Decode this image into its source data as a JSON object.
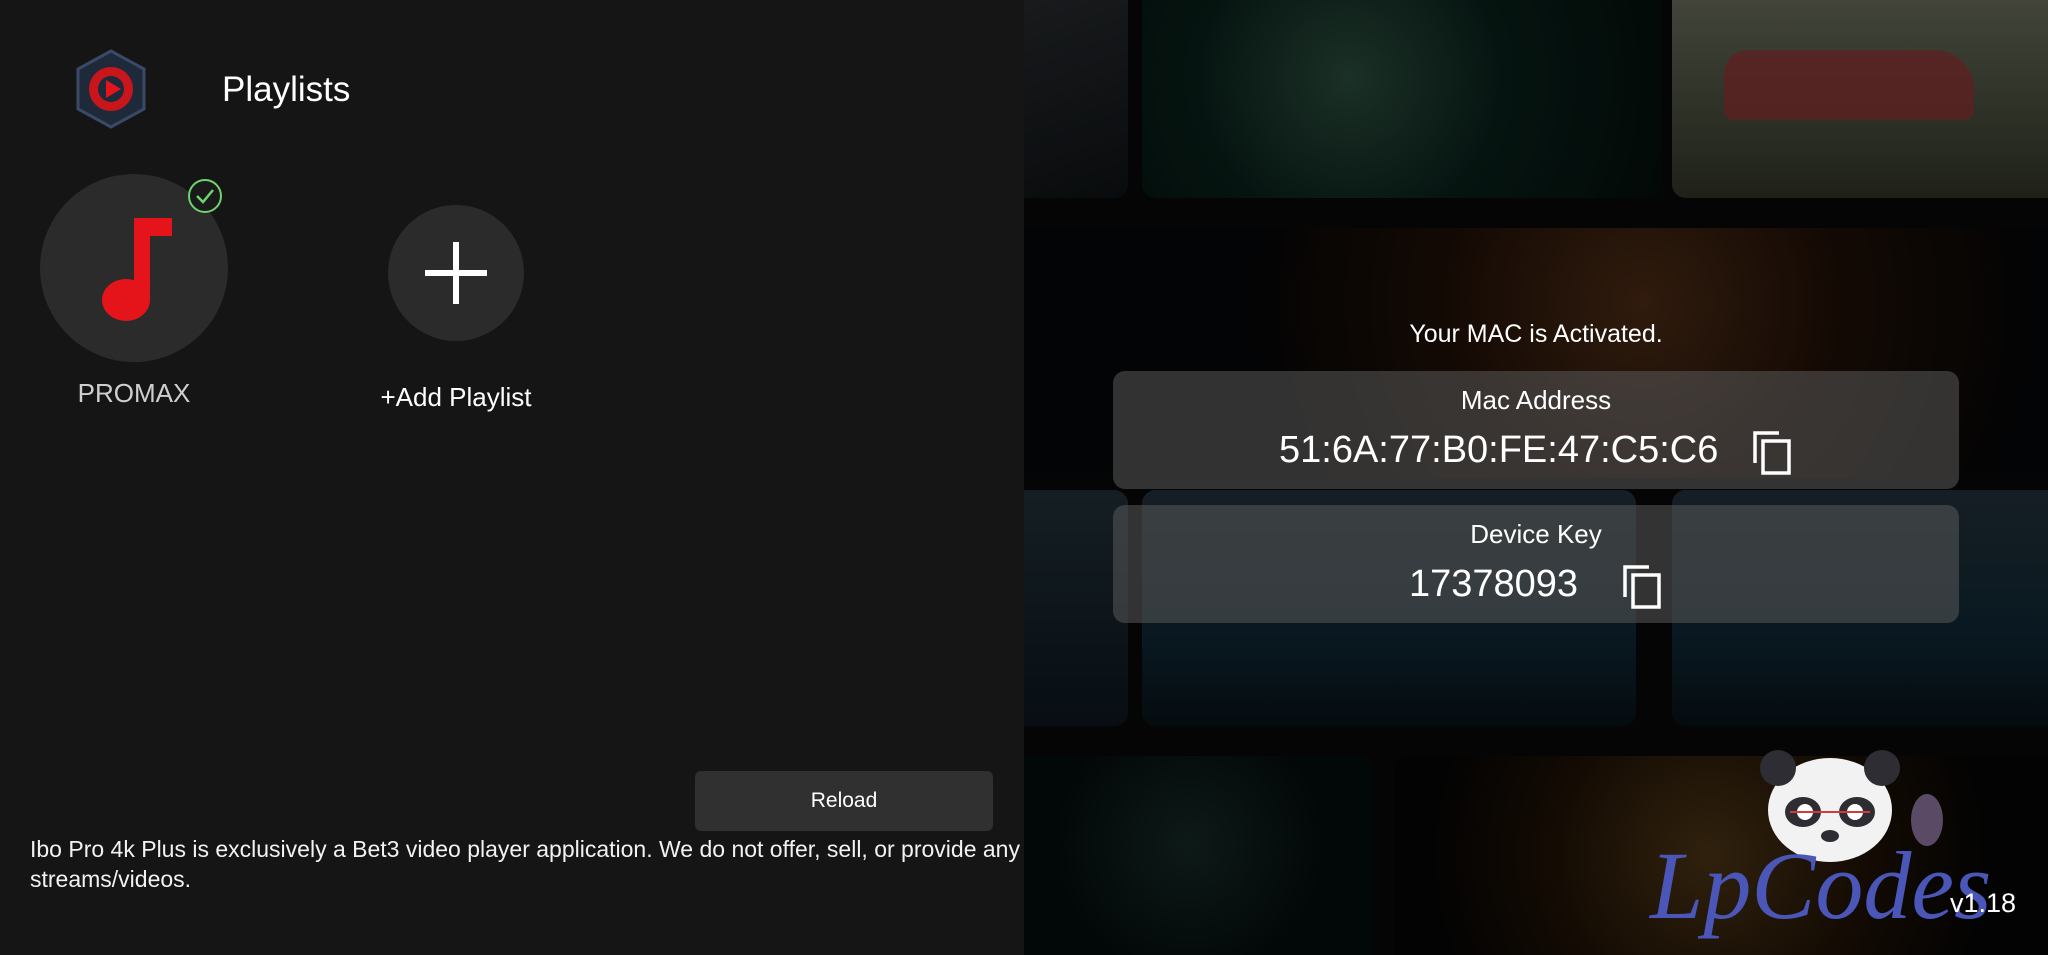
{
  "header": {
    "title": "Playlists"
  },
  "playlists": [
    {
      "label": "PROMAX",
      "active": true,
      "icon": "music-note-icon"
    },
    {
      "label": "+Add Playlist",
      "icon": "plus-icon"
    }
  ],
  "reload_label": "Reload",
  "disclaimer": "Ibo Pro 4k Plus is exclusively a Bet3 video player application. We do not offer, sell, or provide any streams/videos.",
  "activation": {
    "status": "Your MAC is Activated.",
    "mac_label": "Mac Address",
    "mac_value": "51:6A:77:B0:FE:47:C5:C6",
    "key_label": "Device Key",
    "key_value": "17378093"
  },
  "watermark": "LpCodes",
  "version": "v1.18",
  "colors": {
    "accent": "#e5141b",
    "check": "#6fd36f",
    "card": "#5a5a5a"
  }
}
